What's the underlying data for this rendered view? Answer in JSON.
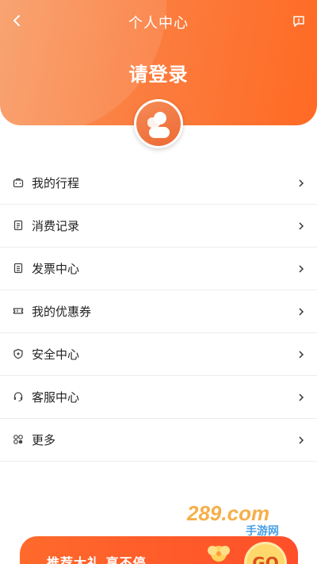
{
  "header": {
    "title": "个人中心",
    "login_prompt": "请登录"
  },
  "menu": [
    {
      "label": "我的行程",
      "icon": "briefcase-icon"
    },
    {
      "label": "消费记录",
      "icon": "receipt-icon"
    },
    {
      "label": "发票中心",
      "icon": "invoice-icon"
    },
    {
      "label": "我的优惠券",
      "icon": "coupon-icon"
    },
    {
      "label": "安全中心",
      "icon": "shield-icon"
    },
    {
      "label": "客服中心",
      "icon": "headset-icon"
    },
    {
      "label": "更多",
      "icon": "grid-icon"
    }
  ],
  "banner": {
    "text": "推荐大礼 享不停",
    "go_label": "GO"
  },
  "watermark": {
    "brand": "289.com",
    "sub": "手游网"
  },
  "colors": {
    "accent": "#ff6a24",
    "icon": "#444444"
  }
}
